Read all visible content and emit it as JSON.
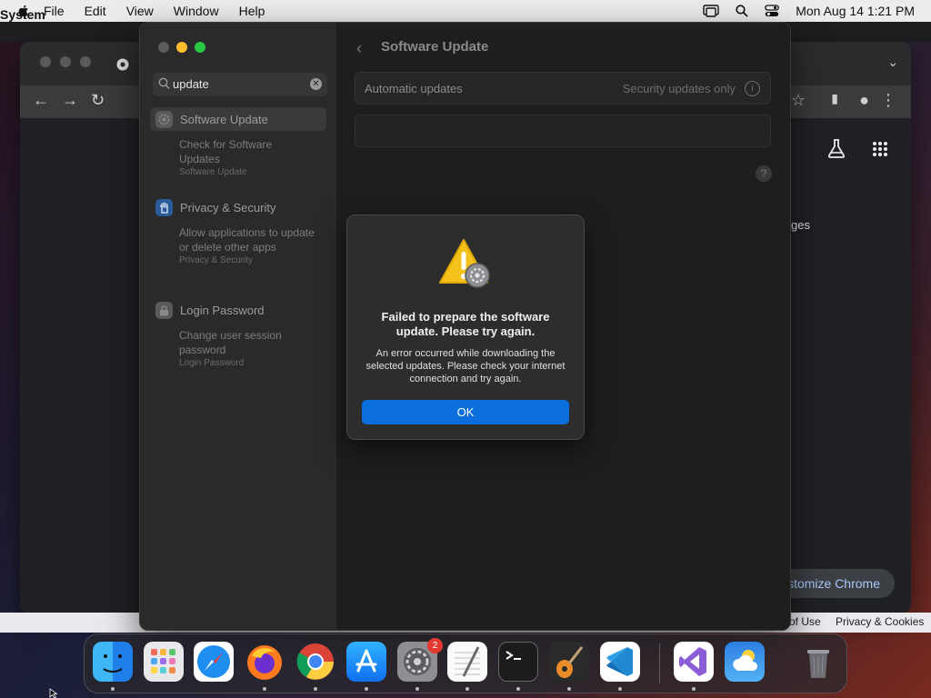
{
  "menubar": {
    "app_name": "System Settings",
    "menus": [
      "File",
      "Edit",
      "View",
      "Window",
      "Help"
    ],
    "clock": "Mon Aug 14  1:21 PM"
  },
  "chrome_bg": {
    "customize_button": "Customize Chrome",
    "partial_text": "ges",
    "footer_left": "of Use",
    "footer_right": "Privacy & Cookies"
  },
  "sidebar": {
    "search_value": "update",
    "results": [
      {
        "label": "Software Update",
        "sub": "Check for Software Updates",
        "category": "Software Update"
      },
      {
        "label": "Privacy & Security",
        "sub": "Allow applications to update or delete other apps",
        "category": "Privacy & Security"
      },
      {
        "label": "Login Password",
        "sub": "Change user session password",
        "category": "Login Password"
      }
    ]
  },
  "content": {
    "title": "Software Update",
    "automatic_updates_label": "Automatic updates",
    "automatic_updates_value": "Security updates only",
    "info_icon": "info-icon",
    "help_icon": "?"
  },
  "alert": {
    "title": "Failed to prepare the software update. Please try again.",
    "message": "An error occurred while downloading the selected updates. Please check your internet connection and try again.",
    "ok_label": "OK"
  },
  "dock": {
    "apps": [
      "Finder",
      "Launchpad",
      "Safari",
      "Firefox",
      "Google Chrome",
      "App Store",
      "System Settings",
      "TextEdit",
      "Terminal",
      "GarageBand",
      "Visual Studio Code",
      "Visual Studio",
      "Weather",
      "Trash"
    ],
    "settings_badge": "2"
  },
  "colors": {
    "accent": "#0a6fdc",
    "badge": "#e5382f"
  }
}
